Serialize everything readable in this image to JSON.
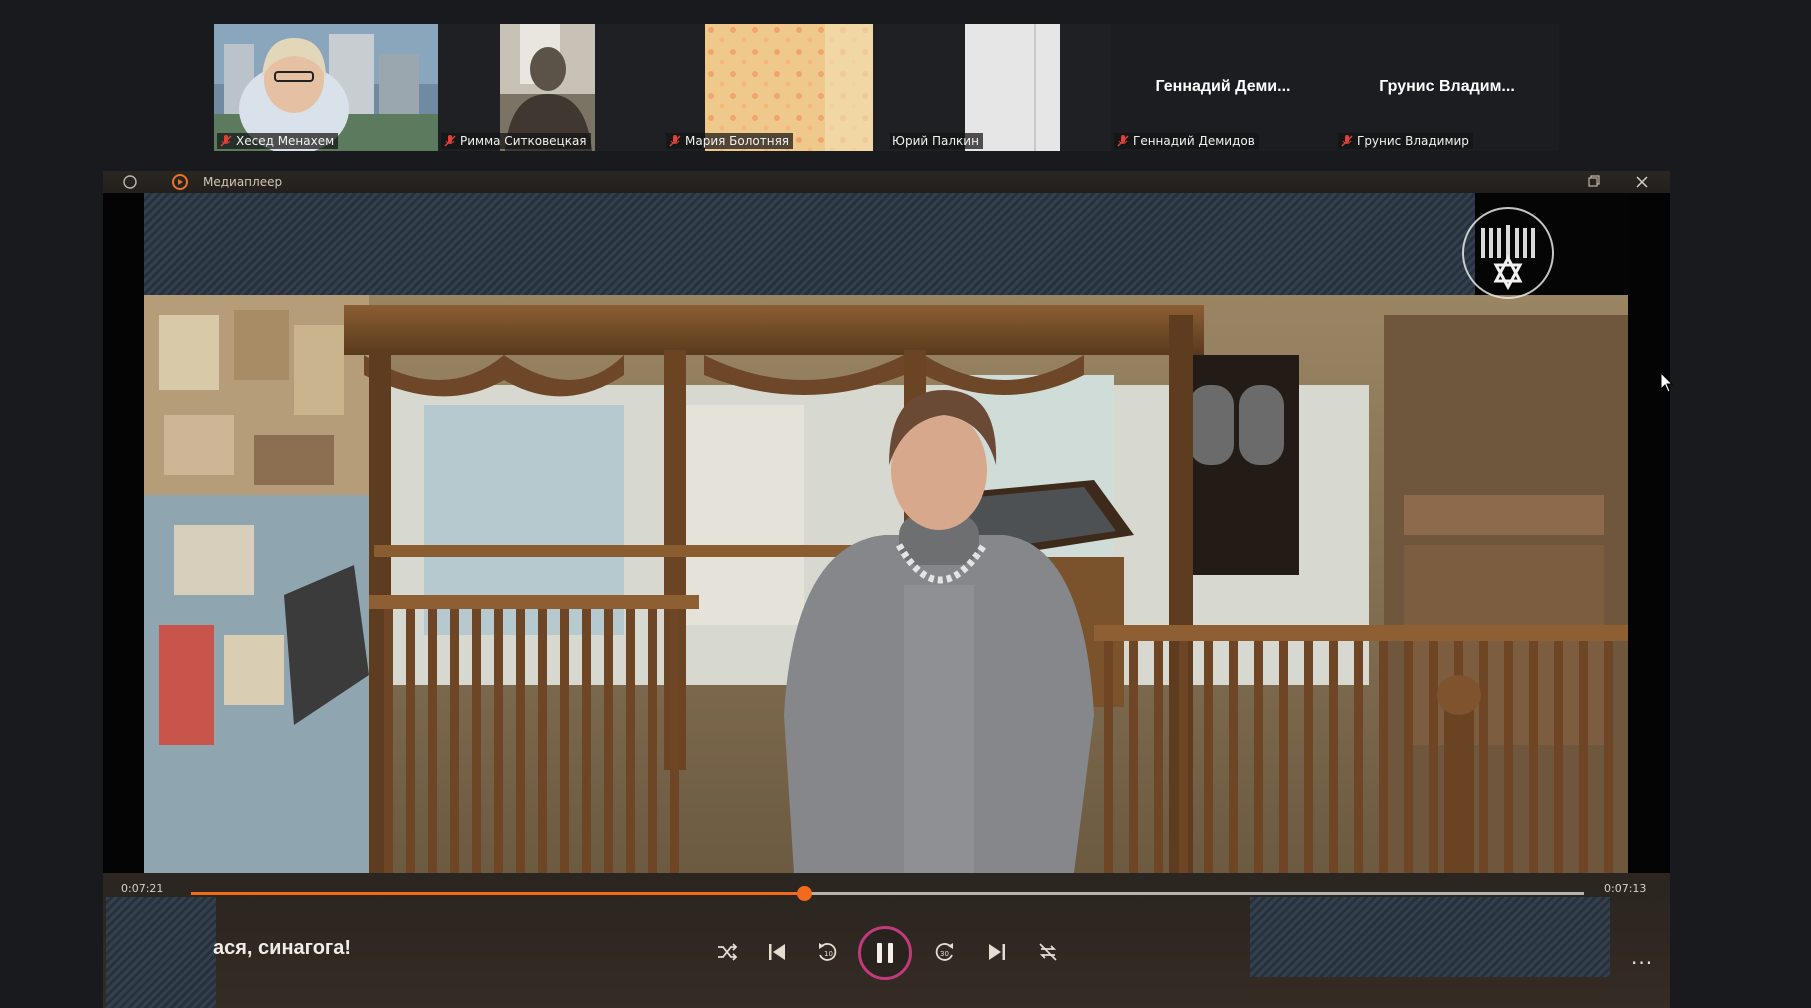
{
  "meeting": {
    "participants": [
      {
        "name": "Хесед Менахем",
        "muted": true,
        "video": "webcam-office"
      },
      {
        "name": "Римма Ситковецкая",
        "muted": true,
        "video": "webcam-room"
      },
      {
        "name": "Мария Болотняя",
        "muted": true,
        "video": "webcam-curtain"
      },
      {
        "name": "Юрий Палкин",
        "muted": false,
        "video": "webcam-wall"
      },
      {
        "name": "Геннадий Демидов",
        "display_name": "Геннадий Деми...",
        "muted": true,
        "video": "off"
      },
      {
        "name": "Грунис Владимир",
        "display_name": "Грунис Владим...",
        "muted": true,
        "video": "off"
      }
    ]
  },
  "player": {
    "window_title": "Медиаплеер",
    "elapsed": "0:07:21",
    "remaining": "0:07:13",
    "progress": 0.44,
    "track_title": "ася, синагога!",
    "more_label": "...",
    "controls": [
      "shuffle-icon",
      "previous-icon",
      "rewind-10-icon",
      "pause-icon",
      "forward-30-icon",
      "next-icon",
      "repeat-off-icon"
    ],
    "colors": {
      "accent": "#f26b1d",
      "play_ring": "#c13a7a"
    }
  }
}
